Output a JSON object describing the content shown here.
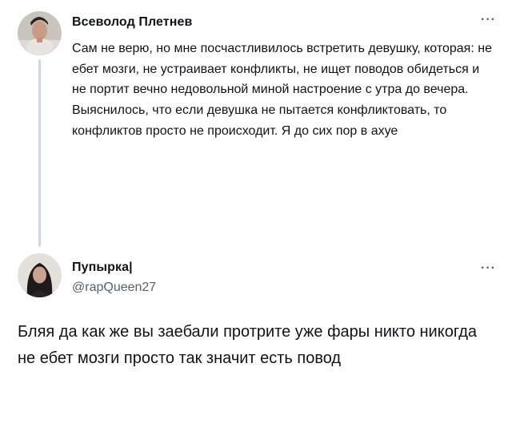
{
  "thread": {
    "reply_author": {
      "name": "Всеволод Плетнев",
      "avatar_icon": "user-avatar-photo"
    },
    "reply_text": "Сам не верю, но мне посчастливилось встретить девушку, которая: не ебет мозги, не устраивает конфликты, не ищет поводов обидеться и не портит вечно недовольной миной настроение с утра до вечера. Выяснилось, что если девушка не пытается конфликтовать, то конфликтов просто не происходит. Я до сих пор в ахуе",
    "reply_more_icon": "more-options-icon",
    "main_author": {
      "name": "Пупырка|",
      "handle": "@rapQueen27",
      "avatar_icon": "user-avatar-photo"
    },
    "main_more_icon": "more-options-icon",
    "main_text": "Бляя да как же вы заебали протрите уже фары никто никогда не ебет мозги просто так значит есть повод"
  },
  "colors": {
    "text": "#0f1419",
    "secondary_text": "#536471",
    "thread_line": "#cfd9de"
  }
}
